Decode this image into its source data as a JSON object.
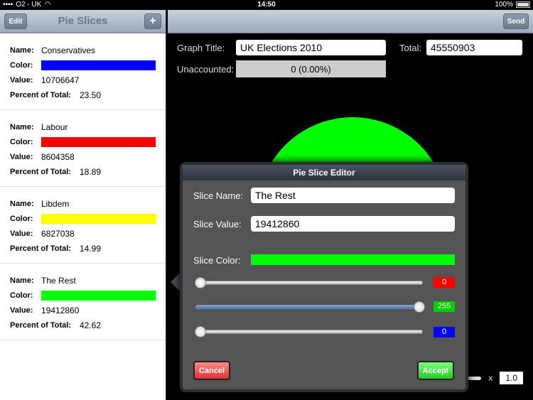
{
  "status": {
    "carrier": "O2 - UK",
    "time": "14:50",
    "battery": "100%"
  },
  "sidebar": {
    "edit_label": "Edit",
    "title": "Pie Slices",
    "add_label": "+",
    "labels": {
      "name": "Name:",
      "color": "Color:",
      "value": "Value:",
      "percent": "Percent of Total:"
    },
    "slices": [
      {
        "name": "Conservatives",
        "color": "#0000ff",
        "value": "10706647",
        "percent": "23.50"
      },
      {
        "name": "Labour",
        "color": "#ff0000",
        "value": "8604358",
        "percent": "18.89"
      },
      {
        "name": "Libdem",
        "color": "#ffff00",
        "value": "6827038",
        "percent": "14.99"
      },
      {
        "name": "The Rest",
        "color": "#00ff00",
        "value": "19412860",
        "percent": "42.62"
      }
    ]
  },
  "main": {
    "send_label": "Send",
    "graph_title_label": "Graph Title:",
    "graph_title_value": "UK Elections 2010",
    "total_label": "Total:",
    "total_value": "45550903",
    "unaccounted_label": "Unaccounted:",
    "unaccounted_value": "0  (0.00%)",
    "scale_x": "x",
    "scale_value": "1.0"
  },
  "editor": {
    "title": "Pie Slice Editor",
    "name_label": "Slice Name:",
    "name_value": "The Rest",
    "value_label": "Slice Value:",
    "value_value": "19412860",
    "color_label": "Slice Color:",
    "color": "#00ff00",
    "red": "0",
    "green": "255",
    "blue": "0",
    "red_color": "#ff0000",
    "green_color": "#00cc00",
    "blue_color": "#0000ff",
    "cancel_label": "Cancel",
    "accept_label": "Accept"
  }
}
